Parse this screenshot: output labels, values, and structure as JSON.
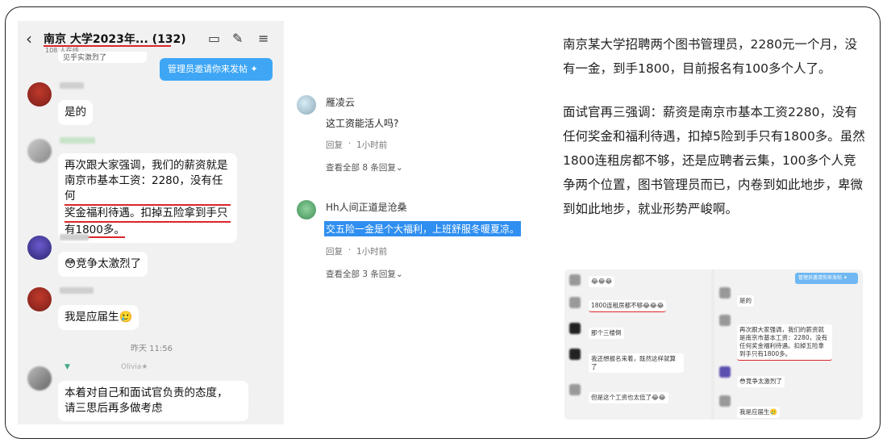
{
  "chat": {
    "group_title": "南京     大学2023年...  (132)",
    "members": "108 人在线",
    "cut_message": "见乎实激烈了",
    "admin_tip": "管理员邀请你来发帖 ✦",
    "msg1": "是的",
    "msg2_line1": "再次跟大家强调，我们的薪资就是",
    "msg2_line2": "南京市基本工资：2280，没有任何",
    "msg2_line3": "奖金福利待遇。扣掉五险拿到手只",
    "msg2_line4": "有1800多。",
    "msg3": "😳竞争太激烈了",
    "msg4": "我是应届生🥲",
    "time": "昨天 11:56",
    "last_name": "Olivia★",
    "msg5_line1": "本着对自己和面试官负责的态度，",
    "msg5_line2": "请三思后再多做考虑"
  },
  "comments": [
    {
      "name": "雁凌云",
      "text": "这工资能活人吗?",
      "reply": "回复",
      "time": "1小时前",
      "more": "查看全部 8 条回复⌄"
    },
    {
      "name": "Hh人间正道是沧桑",
      "text": "交五险一金是个大福利，上班舒服冬暖夏凉。",
      "reply": "回复",
      "time": "1小时前",
      "more": "查看全部 3 条回复⌄"
    }
  ],
  "article": {
    "p1": "南京某大学招聘两个图书管理员，2280元一个月，没有一金，到手1800，目前报名有100多个人了。",
    "p2": "面试官再三强调：薪资是南京市基本工资2280，没有任何奖金和福利待遇，扣掉5险到手只有1800多。虽然1800连租房都不够，还是应聘者云集，100多个人竞争两个位置，图书管理员而已，内卷到如此地步，卑微到如此地步，就业形势严峻啊。"
  },
  "thumb": {
    "left_msgs": [
      "😂😂😂",
      "1800连租房都不够😂😂😂",
      "那个三楼倒",
      "我还想报名来着，既然这样就算了",
      "但是这个工资也太低了😂😂"
    ],
    "tip": "管理员邀请你来发帖 ✦",
    "right_msgs": [
      "是的",
      "再次跟大家强调，我们的薪资就是南京市基本工资：2280，没有任何奖金福利待遇。扣掉五险拿到手只有1800多。",
      "😳竞争太激烈了",
      "我是应届生🥲"
    ]
  }
}
